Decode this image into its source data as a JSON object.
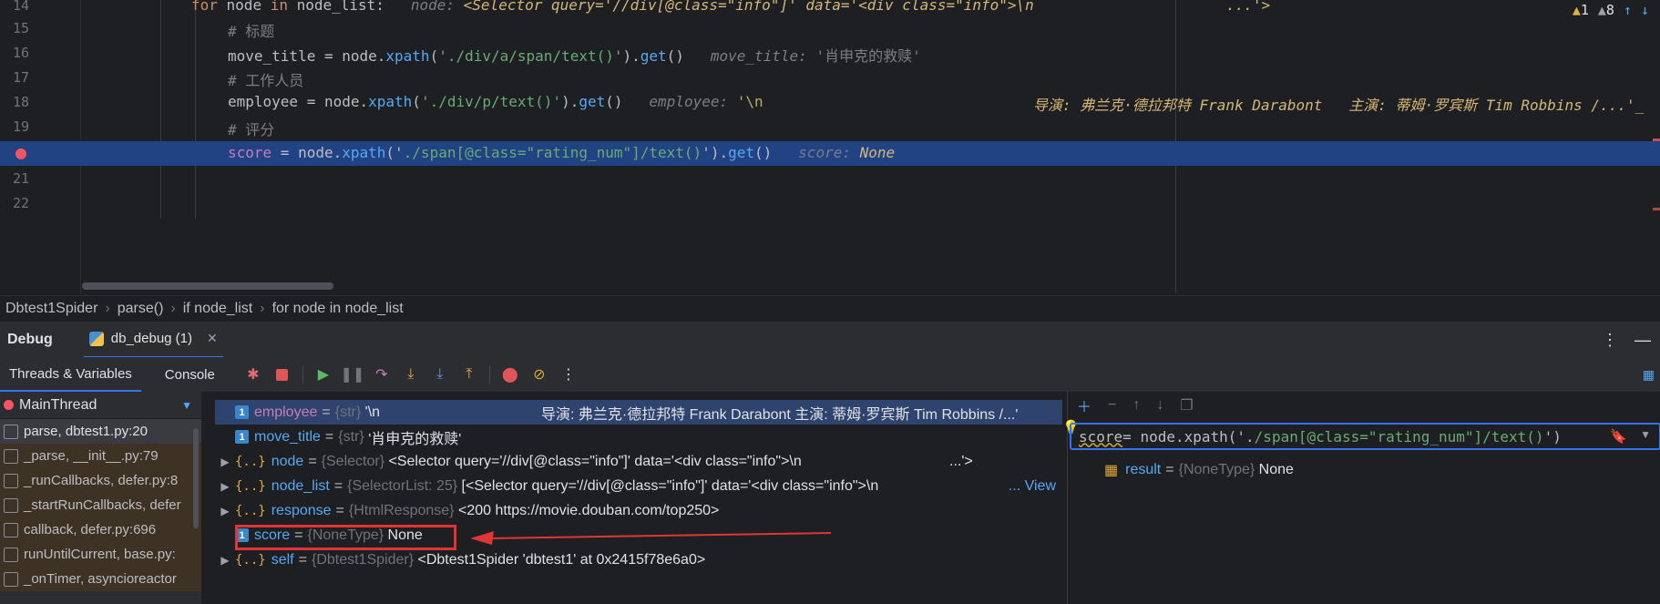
{
  "editor": {
    "lines": [
      {
        "num": "14",
        "kw": "for",
        "text": " node ",
        "kw2": "in",
        "text2": " node_list:",
        "hint_label": "node:",
        "hint_value": "<Selector query='//div[@class=\"info\"]' data='<div class=\"info\">\\n",
        "hint_tail": "...'>"
      },
      {
        "num": "15",
        "comment": "# 标题"
      },
      {
        "num": "16",
        "var": "move_title",
        "op": " = node.",
        "fn": "xpath",
        "open": "(",
        "str": "'./div/a/span/text()'",
        "close": ").",
        "fn2": "get",
        "end": "()",
        "hint_label": "move_title:",
        "hint_value": "'肖申克的救赎'"
      },
      {
        "num": "17",
        "comment": "# 工作人员"
      },
      {
        "num": "18",
        "var": "employee",
        "op": " = node.",
        "fn": "xpath",
        "open": "(",
        "str": "'./div/p/text()'",
        "close": ").",
        "fn2": "get",
        "end": "()",
        "hint_label": "employee:",
        "hint_value": "'\\n",
        "hint_tail": "导演: 弗兰克·德拉邦特 Frank Darabont   主演: 蒂姆·罗宾斯 Tim Robbins /...'_"
      },
      {
        "num": "19",
        "comment": "# 评分"
      },
      {
        "var": "score",
        "op": " = node.",
        "fn": "xpath",
        "open": "('",
        "str": "./span[@class=\"rating_num\"]/text()",
        "close": "').",
        "fn2": "get",
        "end": "()",
        "hint_label": "score:",
        "hint_value": "None"
      },
      {
        "num": "21"
      },
      {
        "num": "22"
      }
    ],
    "inspections": {
      "warnings": "1",
      "weak_warnings": "8"
    }
  },
  "breadcrumb": [
    "Dbtest1Spider",
    "parse()",
    "if node_list",
    "for node in node_list"
  ],
  "debug": {
    "title": "Debug",
    "session_tab": "db_debug (1)",
    "tabs": {
      "threads": "Threads & Variables",
      "console": "Console"
    }
  },
  "frames": {
    "thread": "MainThread",
    "items": [
      "parse, dbtest1.py:20",
      "_parse, __init__.py:79",
      "_runCallbacks, defer.py:8",
      "_startRunCallbacks, defer",
      "callback, defer.py:696",
      "runUntilCurrent, base.py:",
      "_onTimer, asyncioreactor"
    ]
  },
  "variables": [
    {
      "name": "employee",
      "type": "{str}",
      "value": "'\\n",
      "value_tail": "导演: 弗兰克·德拉邦特 Frank Darabont   主演: 蒂姆·罗宾斯 Tim Robbins /...'"
    },
    {
      "name": "move_title",
      "type": "{str}",
      "value": "'肖申克的救赎'"
    },
    {
      "name": "node",
      "type": "{Selector}",
      "value": "<Selector query='//div[@class=\"info\"]' data='<div class=\"info\">\\n",
      "value_tail": "...'>"
    },
    {
      "name": "node_list",
      "type": "{SelectorList: 25}",
      "value": "[<Selector query='//div[@class=\"info\"]' data='<div class=\"info\">\\n",
      "link": "... View"
    },
    {
      "name": "response",
      "type": "{HtmlResponse}",
      "value": "<200 https://movie.douban.com/top250>"
    },
    {
      "name": "score",
      "type": "{NoneType}",
      "value": "None"
    },
    {
      "name": "self",
      "type": "{Dbtest1Spider}",
      "value": "<Dbtest1Spider 'dbtest1' at 0x2415f78e6a0>"
    }
  ],
  "watches": {
    "expression_pre": "score",
    "expression_mid": " = node.xpath('.",
    "expression_str": "/span[@class=\"rating_num\"]/text()",
    "expression_end": "')",
    "result_name": "result",
    "result_type": "{NoneType}",
    "result_value": "None"
  },
  "colors": {
    "accent": "#3574f0",
    "breakpoint": "#f75464",
    "annotation": "#e23434"
  }
}
